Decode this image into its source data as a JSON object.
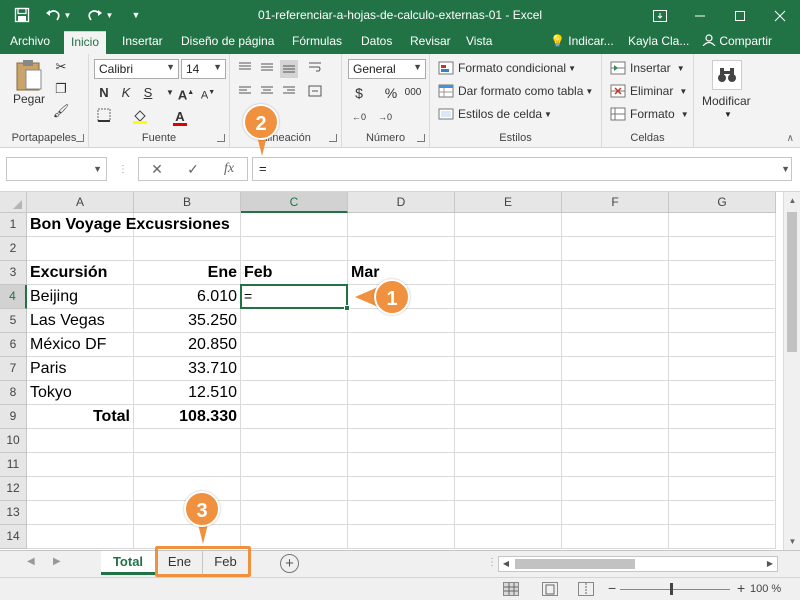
{
  "window": {
    "title": "01-referenciar-a-hojas-de-calculo-externas-01  -  Excel",
    "save_icon": "save-icon",
    "undo_icon": "undo-icon",
    "redo_icon": "redo-icon"
  },
  "tabs": {
    "file": "Archivo",
    "home": "Inicio",
    "insert": "Insertar",
    "page_layout": "Diseño de página",
    "formulas": "Fórmulas",
    "data": "Datos",
    "review": "Revisar",
    "view": "Vista",
    "tell_me": "Indicar...",
    "user": "Kayla Cla...",
    "share": "Compartir"
  },
  "ribbon": {
    "clipboard": {
      "paste": "Pegar",
      "label": "Portapapeles"
    },
    "font": {
      "name": "Calibri",
      "size": "14",
      "bold": "N",
      "italic": "K",
      "underline": "S",
      "label": "Fuente"
    },
    "alignment": {
      "label": "Alineación"
    },
    "number": {
      "format": "General",
      "currency": "$",
      "percent": "%",
      "label": "Número"
    },
    "styles": {
      "conditional": "Formato condicional",
      "as_table": "Dar formato como tabla",
      "cell_styles": "Estilos de celda",
      "label": "Estilos"
    },
    "cells": {
      "insert": "Insertar",
      "delete": "Eliminar",
      "format": "Formato",
      "label": "Celdas"
    },
    "editing": {
      "label": "Modificar"
    }
  },
  "formula_bar": {
    "name_box": "",
    "cancel": "✕",
    "enter": "✓",
    "fx": "fx",
    "content": "="
  },
  "columns": [
    "A",
    "B",
    "C",
    "D",
    "E",
    "F",
    "G"
  ],
  "rows": [
    "1",
    "2",
    "3",
    "4",
    "5",
    "6",
    "7",
    "8",
    "9",
    "10",
    "11",
    "12",
    "13",
    "14"
  ],
  "cells": {
    "A1": "Bon Voyage Excusrsiones",
    "A3": "Excursión",
    "B3": "Ene",
    "C3": "Feb",
    "D3": "Mar",
    "A4": "Beijing",
    "B4": "6.010",
    "C4": "=",
    "A5": "Las Vegas",
    "B5": "35.250",
    "A6": "México DF",
    "B6": "20.850",
    "A7": "Paris",
    "B7": "33.710",
    "A8": "Tokyo",
    "B8": "12.510",
    "A9": "Total",
    "B9": "108.330"
  },
  "sheet_tabs": [
    "Total",
    "Ene",
    "Feb"
  ],
  "active_sheet": "Total",
  "status": {
    "zoom": "100 %"
  },
  "callouts": [
    "1",
    "2",
    "3"
  ],
  "colors": {
    "excel_green": "#217346",
    "callout_orange": "#f0913f"
  }
}
